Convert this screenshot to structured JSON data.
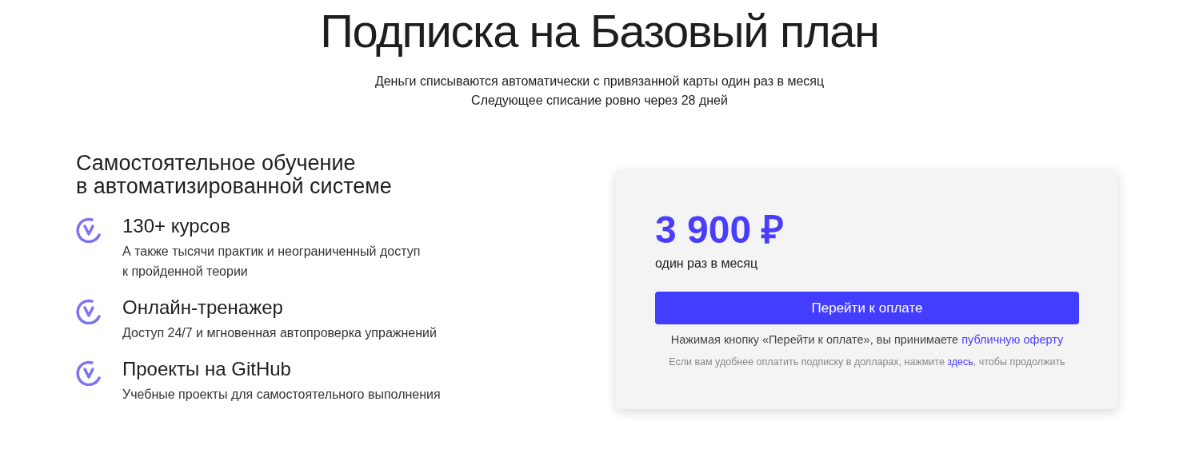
{
  "title": "Подписка на Базовый план",
  "subtitle": [
    "Деньги списываются автоматически с привязанной карты один раз в месяц",
    "Следующее списание ровно через 28 дней"
  ],
  "features_heading": [
    "Самостоятельное обучение",
    "в автоматизированной системе"
  ],
  "features": [
    {
      "title": "130+ курсов",
      "description": [
        "А также тысячи практик и неограниченный доступ",
        "к пройденной теории"
      ]
    },
    {
      "title": "Онлайн-тренажер",
      "description": [
        "Доступ 24/7 и мгновенная автопроверка упражнений"
      ]
    },
    {
      "title": "Проекты на GitHub",
      "description": [
        "Учебные проекты для самостоятельного выполнения"
      ]
    }
  ],
  "card": {
    "price": "3 900 ₽",
    "period": "один раз в месяц",
    "button": "Перейти к оплате",
    "offer_note": {
      "before": "Нажимая кнопку «Перейти к оплате», вы принимаете ",
      "link": "публичную оферту"
    },
    "dollar_note": {
      "before": "Если вам удобнее оплатить подписку в долларах, нажмите ",
      "link": "здесь",
      "after": ", чтобы продолжить"
    }
  }
}
